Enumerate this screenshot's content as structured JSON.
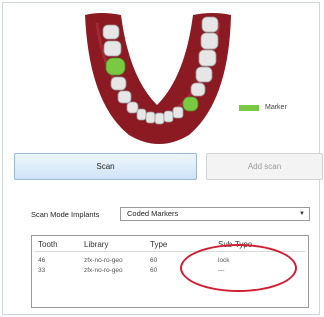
{
  "legend": {
    "label": "Marker",
    "color": "#7ac943"
  },
  "jaw_colors": {
    "gum": "#8b1a22",
    "tooth": "#e6e6e6",
    "marker": "#7ac943"
  },
  "buttons": {
    "scan": "Scan",
    "add_scan": "Add scan"
  },
  "scan_mode": {
    "label": "Scan Mode Implants",
    "value": "Coded Markers"
  },
  "table": {
    "headers": {
      "tooth": "Tooth",
      "library": "Library",
      "type": "Type",
      "subtype": "Sub-Type"
    },
    "rows": [
      {
        "tooth": "46",
        "library": "zfx-no-ro-geo",
        "type": "60",
        "subtype": "lock"
      },
      {
        "tooth": "33",
        "library": "zfx-no-ro-geo",
        "type": "60",
        "subtype": "---"
      }
    ]
  },
  "annotation_color": "#d01e36"
}
